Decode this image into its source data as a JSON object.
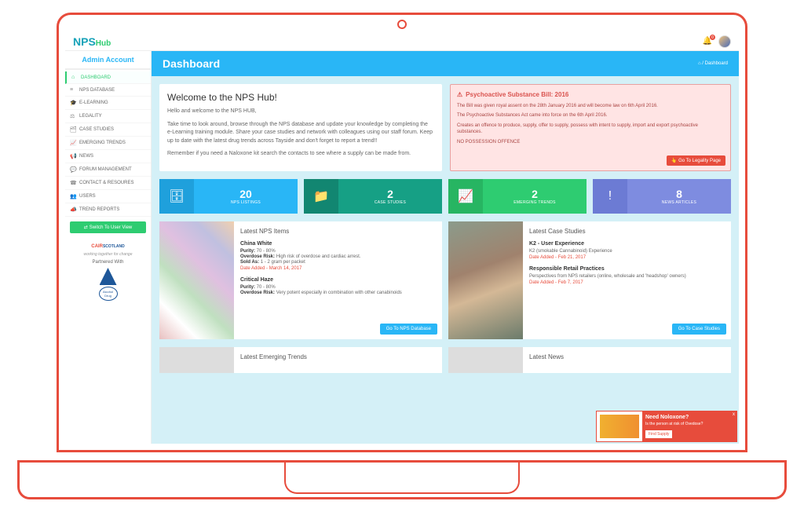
{
  "logo": {
    "prefix": "NPS",
    "suffix": "Hub"
  },
  "notif_count": "0",
  "account_label": "Admin Account",
  "nav": [
    {
      "icon": "⌂",
      "label": "DASHBOARD",
      "active": true
    },
    {
      "icon": "≡",
      "label": "NPS DATABASE"
    },
    {
      "icon": "🎓",
      "label": "E-LEARNING"
    },
    {
      "icon": "⚖",
      "label": "LEGALITY"
    },
    {
      "icon": "🗂",
      "label": "CASE STUDIES"
    },
    {
      "icon": "📈",
      "label": "EMERGING TRENDS"
    },
    {
      "icon": "📢",
      "label": "NEWS"
    },
    {
      "icon": "💬",
      "label": "FORUM MANAGEMENT"
    },
    {
      "icon": "☎",
      "label": "CONTACT & RESOURES"
    },
    {
      "icon": "👥",
      "label": "USERS"
    },
    {
      "icon": "📣",
      "label": "TREND REPORTS"
    }
  ],
  "switch_label": "Switch To User View",
  "partner": {
    "cair_c": "CAIR",
    "cair_s": "SCOTLAND",
    "tag": "working together for change",
    "partnered": "Partnered With",
    "adp": "Alcohol Drug"
  },
  "pghdr": {
    "title": "Dashboard",
    "crumb_home": "⌂",
    "crumb_sep": " / ",
    "crumb_cur": "Dashboard"
  },
  "welcome": {
    "title": "Welcome to the NPS Hub!",
    "p1": "Hello and welcome to the NPS HUB,",
    "p2": "Take time to look around, browse through the NPS database and update your knowledge by completing the e-Learning training module. Share your case studies and network with colleagues using our staff forum. Keep up to date with the latest drug trends across Tayside and don't forget to report a trend!!",
    "p3": "Remember if you need a Naloxone kit search the contacts to see where a supply can be made from."
  },
  "alert": {
    "title": "Psychoactive Substance Bill: 2016",
    "l1": "The Bill was given royal assent on the 28th January 2016 and will become law on 6th April 2016.",
    "l2": "The Psychoactive Substances Act came into force on the 6th April 2016.",
    "l3": "Creates an offence to produce, supply, offer to supply, possess with intent to supply, import and export psychoactive substances.",
    "l4": "NO POSSESSION OFFENCE",
    "btn": "Go To Legality Page"
  },
  "stats": [
    {
      "icon": "🗄",
      "num": "20",
      "label": "NPS LISTINGS"
    },
    {
      "icon": "📁",
      "num": "2",
      "label": "CASE STUDIES"
    },
    {
      "icon": "📈",
      "num": "2",
      "label": "EMERGING TRENDS"
    },
    {
      "icon": "!",
      "num": "8",
      "label": "NEWS ARTICLES"
    }
  ],
  "nps_panel": {
    "title": "Latest NPS Items",
    "btn": "Go To NPS Database",
    "items": [
      {
        "title": "China White",
        "purity": "70 - 80%",
        "risk": "High risk of overdose and cardiac arrest.",
        "sold": "1 - 2 gram per packet",
        "date": "Date Added - March 14, 2017"
      },
      {
        "title": "Critical Haze",
        "purity": "70 - 80%",
        "risk": "Very potent especially in combination with other canabinoids",
        "date": ""
      }
    ],
    "lbl_purity": "Purity: ",
    "lbl_risk": "Overdose Risk: ",
    "lbl_sold": "Sold As: "
  },
  "cs_panel": {
    "title": "Latest Case Studies",
    "btn": "Go To Case Studies",
    "items": [
      {
        "title": "K2 - User Experience",
        "desc": "K2 (smokable Cannabinoid) Experience",
        "date": "Date Added - Feb 21, 2017"
      },
      {
        "title": "Responsible Retail Practices",
        "desc": "Perspectives from NPS retailers (online, wholesale and 'headshop' owners)",
        "date": "Date Added - Feb 7, 2017"
      }
    ]
  },
  "bottom": {
    "trends": "Latest Emerging Trends",
    "news": "Latest News"
  },
  "toast": {
    "title": "Need Noloxone?",
    "desc": "Is the person at risk of Ovedose?",
    "btn": "Find Supply",
    "close": "x"
  }
}
